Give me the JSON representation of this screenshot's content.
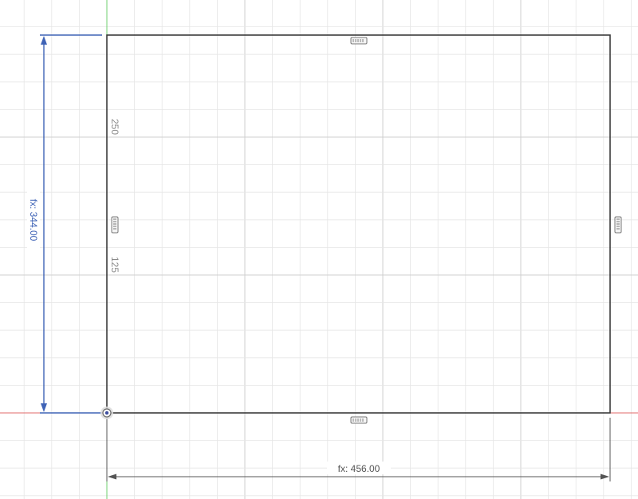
{
  "sketch": {
    "grid": {
      "minor_color": "#e6e6e6",
      "major_color": "#cfcfcf"
    },
    "axes": {
      "x_axis_color": "#e06a6a",
      "y_axis_color": "#6fcf6f"
    },
    "profile": {
      "line_color": "#3b3b3b"
    },
    "dimensions": {
      "height": {
        "label": "fx: 344.00",
        "color": "#3f63b6"
      },
      "width": {
        "label": "fx: 456.00",
        "color": "#555555"
      }
    },
    "ruler": {
      "label_250": "250",
      "label_125": "125",
      "color": "#8a8a8a"
    },
    "constraints": [
      "horizontal-constraint-icon",
      "vertical-constraint-icon"
    ],
    "origin": {
      "icon": "origin-point-icon"
    }
  }
}
